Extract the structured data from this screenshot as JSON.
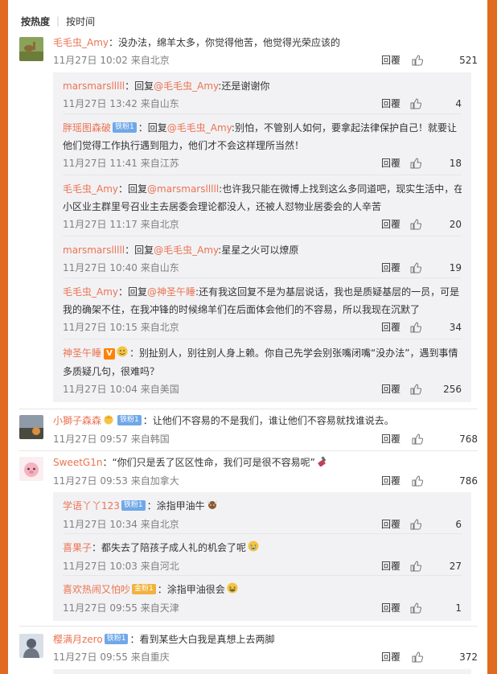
{
  "sort": {
    "hot": "按热度",
    "time": "按时间"
  },
  "reply_label": "回覆",
  "comments": [
    {
      "user": "毛毛虫_Amy",
      "sep": "：",
      "text": "没办法，绵羊太多，你觉得他苦，他觉得光荣应该的",
      "time": "11月27日 10:02",
      "from": "来自北京",
      "likes": "521"
    },
    {
      "user": "小獅子森森",
      "sep": "：",
      "text": "让他们不容易的不是我们，谁让他们不容易就找谁说去。",
      "time": "11月27日 09:57",
      "from": "来自韩国",
      "likes": "768",
      "badge": "铁粉1"
    },
    {
      "user": "SweetG1n",
      "sep": "：",
      "text": "“你们只是丢了区区性命，我们可是很不容易呢”",
      "time": "11月27日 09:53",
      "from": "来自加拿大",
      "likes": "786"
    },
    {
      "user": "樱满月zero",
      "sep": "：",
      "text": "看到某些大白我是真想上去两脚",
      "time": "11月27日 09:55",
      "from": "来自重庆",
      "likes": "372",
      "badge": "铁粉1"
    }
  ],
  "subs1": [
    {
      "user": "marsmarslllll",
      "sep": "：回复",
      "at": "@毛毛虫_Amy",
      "text": ":还是谢谢你",
      "time": "11月27日 13:42",
      "from": "来自山东",
      "likes": "4"
    },
    {
      "user": "胖瑶图森破",
      "badge": "铁粉1",
      "sep": "：回复",
      "at": "@毛毛虫_Amy",
      "text": ":别怕，不管别人如何，要拿起法律保护自己！就要让",
      "text2": "他们觉得工作执行遇到阻力，他们才不会这样理所当然！",
      "time": "11月27日 11:41",
      "from": "来自江苏",
      "likes": "18"
    },
    {
      "user": "毛毛虫_Amy",
      "sep": "：回复",
      "at": "@marsmarslllll",
      "text": ":也许我只能在微博上找到这么多同道吧，现实生活中，在",
      "text2": "小区业主群里号召业主去居委会理论都没人，还被人怼物业居委会的人辛苦",
      "time": "11月27日 11:17",
      "from": "来自北京",
      "likes": "20"
    },
    {
      "user": "marsmarslllll",
      "sep": "：回复",
      "at": "@毛毛虫_Amy",
      "text": ":星星之火可以燎原",
      "time": "11月27日 10:40",
      "from": "来自山东",
      "likes": "19"
    },
    {
      "user": "毛毛虫_Amy",
      "sep": "：回复",
      "at": "@神圣午睡",
      "text": ":还有我这回复不是为基层说话，我也是质疑基层的一员，可是",
      "text2": "我的确架不住，在我冲锋的时候绵羊们在后面体会他们的不容易，所以我现在沉默了",
      "time": "11月27日 10:15",
      "from": "来自北京",
      "likes": "34"
    },
    {
      "user": "神圣午睡",
      "sep": "：别扯别人，别往别人身上赖。你自己先学会别张嘴闭嘴“没办法”，遇到事情",
      "text2": "多质疑几句，很难吗？",
      "time": "11月27日 10:04",
      "from": "来自美国",
      "likes": "256"
    }
  ],
  "subs2": [
    {
      "user": "学语丫丫123",
      "badge": "铁粉1",
      "sep": "：",
      "text": "涂指甲油牛",
      "time": "11月27日 10:34",
      "from": "来自北京",
      "likes": "6"
    },
    {
      "user": "喜果子",
      "sep": "：",
      "text": "都失去了陪孩子成人礼的机会了呢",
      "time": "11月27日 10:03",
      "from": "来自河北",
      "likes": "27"
    },
    {
      "user": "喜欢热闹又怕吵",
      "badge": "金粉1",
      "sep": "：",
      "text": "涂指甲油很会",
      "time": "11月27日 09:55",
      "from": "来自天津",
      "likes": "1"
    }
  ],
  "colors": {
    "border": "#e06a1f",
    "accent": "#eb7350",
    "badge_blue": "#6fa8e8",
    "badge_gold": "#f0b33c",
    "sub_bg": "#f2f2f5"
  }
}
